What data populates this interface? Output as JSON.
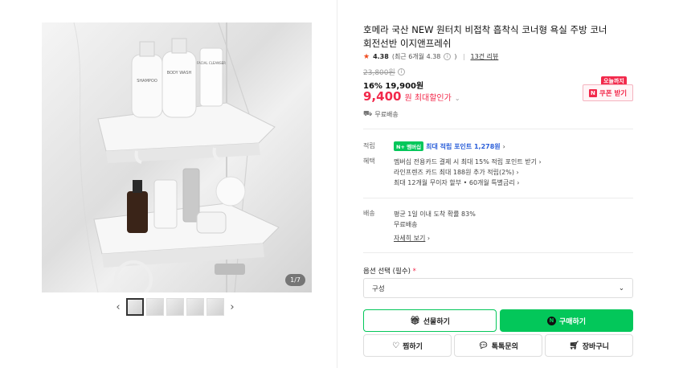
{
  "gallery": {
    "counter": "1/7",
    "prev_arrow": "‹",
    "next_arrow": "›",
    "thumbnails": 5,
    "product_labels": {
      "shampoo": "SHAMPOO",
      "body_wash": "BODY WASH",
      "facial_cleanser": "FACIAL CLEANSER"
    }
  },
  "product": {
    "title": "호메라 국산 NEW 원터치 비접착 흡착식 코너형 욕실 주방 코너회전선반 이지앤프레쉬",
    "rating": "4.38",
    "rating_recent": "(최근 6개월 4.38",
    "rating_close": ")",
    "review_link": "13건 리뷰",
    "original_price": "23,800원",
    "discount": "16% 19,900원",
    "final_price": "9,400",
    "final_suffix": "원 최대할인가",
    "shipping": "무료배송"
  },
  "coupon": {
    "badge": "오늘까지",
    "button": "쿠폰 받기",
    "n_mark": "N"
  },
  "benefits": {
    "points_label": "적립",
    "npay_tag": "N+ 멤버십",
    "points_text": "최대 적립 포인트 1,278원",
    "perks_label": "혜택",
    "perks": [
      "멤버십 전용카드 결제 시 최대 15% 적립 포인트 받기",
      "라인프렌즈 카드 최대 188원 추가 적립(2%)",
      "최대 12개월 무이자 할부 • 60개월 특별금리"
    ],
    "delivery_label": "배송",
    "delivery_lines": [
      "평균 1일 이내 도착 확률 83%",
      "무료배송"
    ],
    "detail_link": "자세히 보기"
  },
  "option": {
    "label": "옵션 선택 (필수)",
    "required_mark": "*",
    "selected": "구성"
  },
  "buttons": {
    "gift": "선물하기",
    "buy": "구매하기",
    "wish": "찜하기",
    "talk": "톡톡문의",
    "cart": "장바구니"
  },
  "colors": {
    "accent_green": "#03c75a",
    "price_red": "#f2294b",
    "point_blue": "#2b5fd9"
  },
  "icons": [
    "star-icon",
    "info-icon",
    "truck-icon",
    "chevron-down-icon",
    "gift-icon",
    "heart-icon",
    "chat-icon",
    "cart-icon"
  ]
}
